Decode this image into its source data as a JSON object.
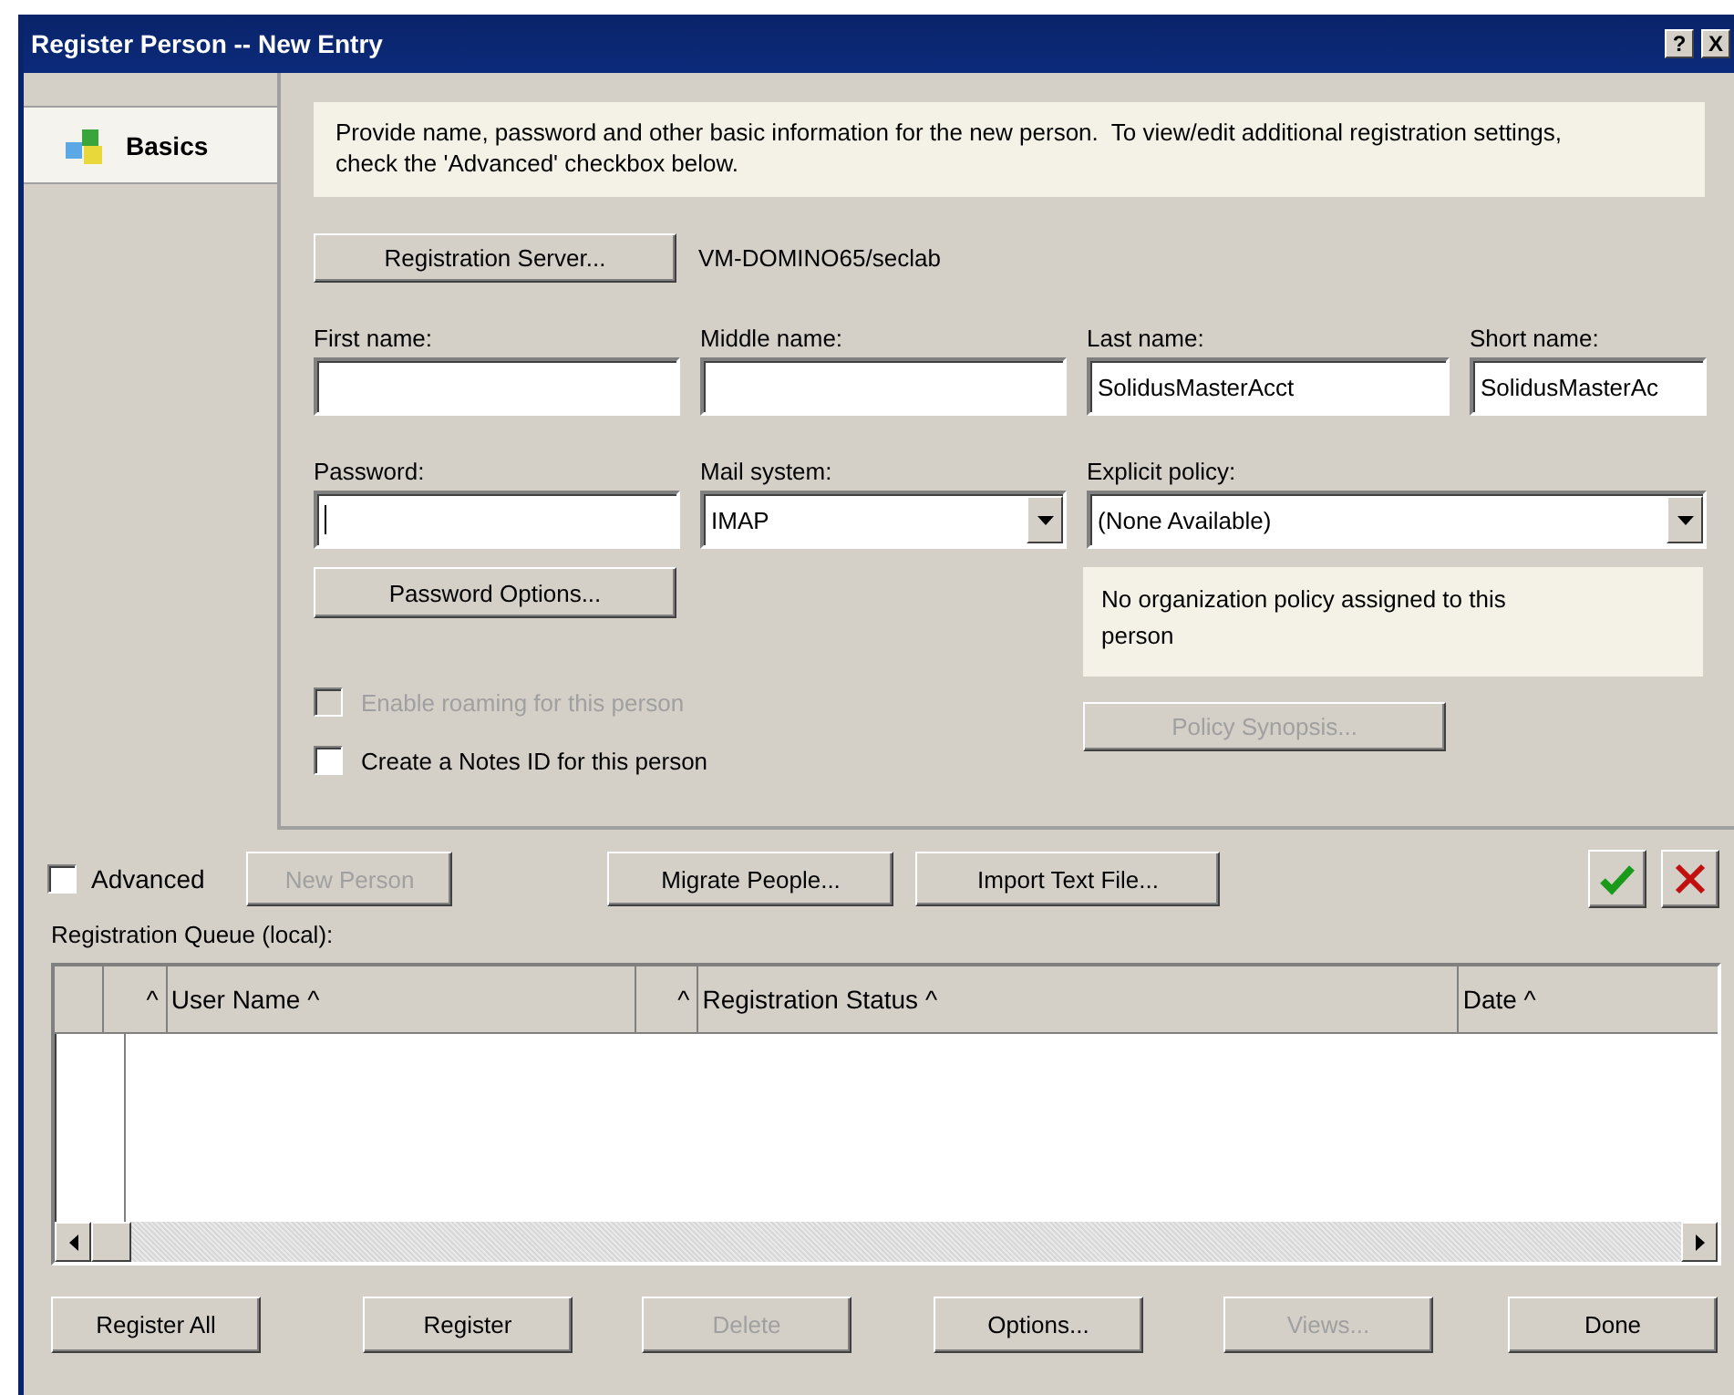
{
  "window": {
    "title": "Register Person -- New Entry",
    "title_buttons": [
      {
        "kind": "help",
        "label": "?"
      },
      {
        "kind": "close",
        "label": "X"
      }
    ]
  },
  "sidebar": {
    "items": [
      {
        "label": "Basics",
        "selected": true
      }
    ]
  },
  "info_text": "Provide name, password and other basic information for the new person.  To view/edit additional registration settings, check the 'Advanced' checkbox below.",
  "registration_server": {
    "button": "Registration Server...",
    "value": "VM-DOMINO65/seclab"
  },
  "name_fields": [
    {
      "label": "First name:"
    },
    {
      "label": "Middle name:"
    },
    {
      "label": "Last name:",
      "value": "SolidusMasterAcct"
    },
    {
      "label": "Short name:",
      "value": "SolidusMasterAc"
    }
  ],
  "password": {
    "label": "Password:",
    "focused": true
  },
  "mail_system": {
    "label": "Mail system:",
    "value": "IMAP"
  },
  "explicit_policy": {
    "label": "Explicit policy:",
    "value": "(None Available)"
  },
  "password_options_button": "Password Options...",
  "policy_note": "No organization policy assigned to this person",
  "policy_synopsis_button": {
    "label": "Policy Synopsis...",
    "disabled": true
  },
  "checkboxes": [
    {
      "label": "Enable roaming for this person",
      "checked": false,
      "disabled": true
    },
    {
      "label": "Create a Notes ID for this person",
      "checked": false,
      "disabled": false
    }
  ],
  "advanced": {
    "label": "Advanced",
    "checked": false
  },
  "action_buttons": [
    {
      "label": "New Person",
      "disabled": true
    },
    {
      "label": "Migrate People...",
      "disabled": false
    },
    {
      "label": "Import Text File...",
      "disabled": false
    }
  ],
  "queue_label": "Registration Queue (local):",
  "table": {
    "columns": [
      {
        "marker": "^",
        "label": "User Name",
        "sort": "^"
      },
      {
        "marker": "^",
        "label": "Registration Status",
        "sort": "^"
      },
      {
        "label": "Date",
        "sort": "^"
      }
    ]
  },
  "bottom_buttons": [
    {
      "label": "Register All",
      "disabled": false
    },
    {
      "label": "Register",
      "disabled": false
    },
    {
      "label": "Delete",
      "disabled": true
    },
    {
      "label": "Options...",
      "disabled": false
    },
    {
      "label": "Views...",
      "disabled": true
    },
    {
      "label": "Done",
      "disabled": false
    }
  ]
}
